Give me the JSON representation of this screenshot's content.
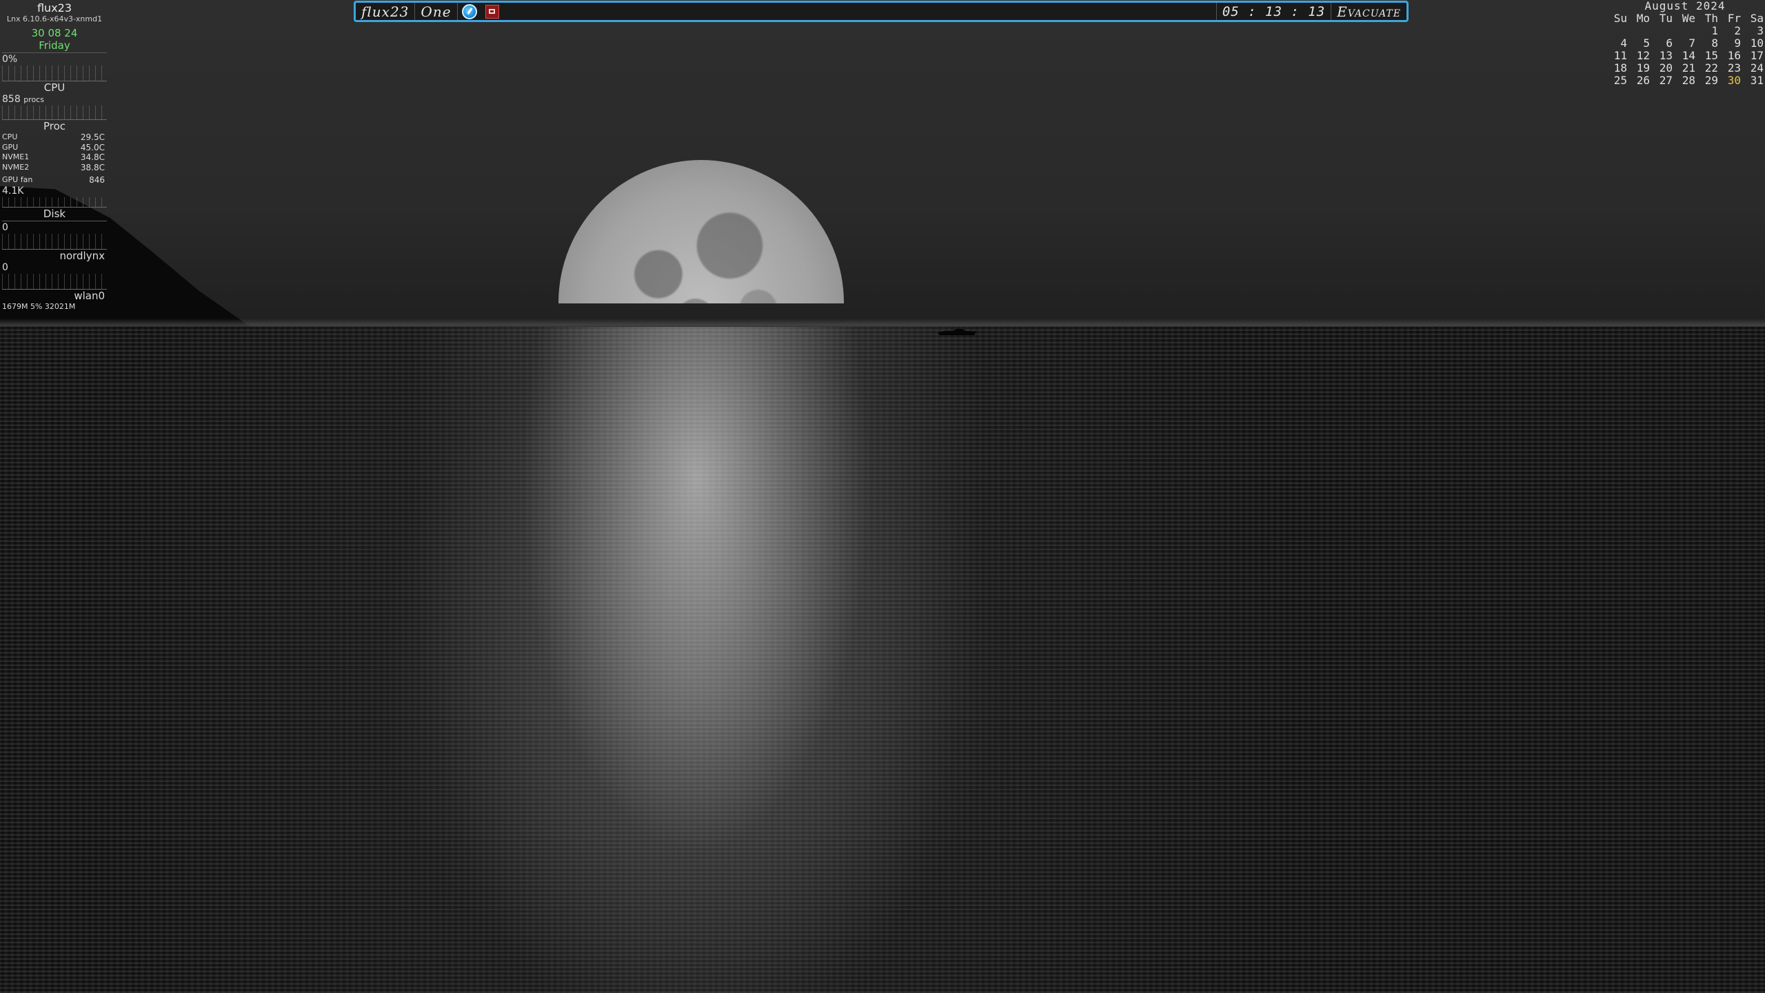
{
  "topbar": {
    "workspace_name": "flux23",
    "desktop_name": "One",
    "clock": "05 : 13 : 13",
    "exit_label": "Evacuate",
    "accent_color": "#3aa7e0"
  },
  "conky": {
    "hostname": "flux23",
    "kernel": "Lnx 6.10.6-x64v3-xnmd1",
    "date": "30 08 24",
    "weekday": "Friday",
    "cpu_usage": "0%",
    "cpu_header": "CPU",
    "procs_count": "858",
    "procs_label": "procs",
    "proc_header": "Proc",
    "sensors": [
      {
        "label": "CPU",
        "value": "29.5C"
      },
      {
        "label": "GPU",
        "value": "45.0C"
      },
      {
        "label": "NVME1",
        "value": "34.8C"
      },
      {
        "label": "NVME2",
        "value": "38.8C"
      },
      {
        "label": "GPU fan",
        "value": "846"
      }
    ],
    "mem_value": "4.1K",
    "disk_header": "Disk",
    "disk_value": "0",
    "net1_name": "nordlynx",
    "net1_value": "0",
    "net2_name": "wlan0",
    "footer": "1679M  5%  32021M",
    "date_color": "#6ee06e"
  },
  "calendar": {
    "title": "August 2024",
    "weekdays": [
      "Su",
      "Mo",
      "Tu",
      "We",
      "Th",
      "Fr",
      "Sa"
    ],
    "weeks": [
      [
        "",
        "",
        "",
        "",
        "1",
        "2",
        "3"
      ],
      [
        "4",
        "5",
        "6",
        "7",
        "8",
        "9",
        "10"
      ],
      [
        "11",
        "12",
        "13",
        "14",
        "15",
        "16",
        "17"
      ],
      [
        "18",
        "19",
        "20",
        "21",
        "22",
        "23",
        "24"
      ],
      [
        "25",
        "26",
        "27",
        "28",
        "29",
        "30",
        "31"
      ]
    ],
    "today": "30",
    "today_color": "#e8c440"
  }
}
